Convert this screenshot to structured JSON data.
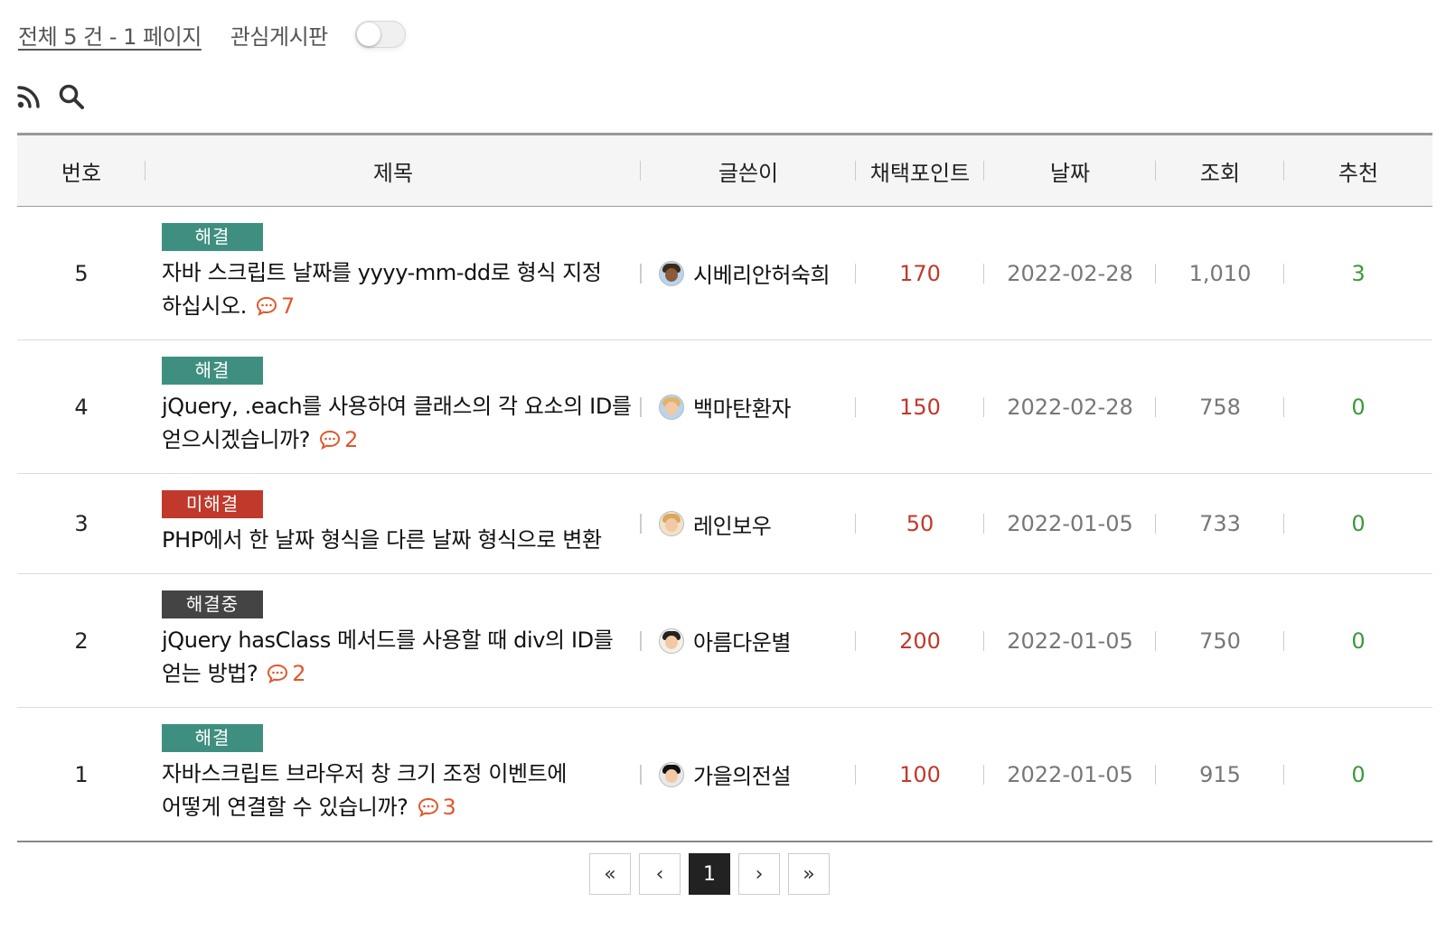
{
  "summary": {
    "total_text": "전체 5 건 - 1 페이지",
    "favorites_label": "관심게시판",
    "favorites_enabled": false
  },
  "tools": {
    "rss_icon": "rss-icon",
    "search_icon": "search-icon"
  },
  "columns": {
    "num": "번호",
    "title": "제목",
    "author": "글쓴이",
    "points": "채택포인트",
    "date": "날짜",
    "views": "조회",
    "recommend": "추천"
  },
  "posts": [
    {
      "num": "5",
      "status": "해결",
      "title": "자바 스크립트 날짜를 yyyy-mm-dd로 형식 지정 하십시오.",
      "comments": "7",
      "author": "시베리안허숙희",
      "points": "170",
      "date": "2022-02-28",
      "views": "1,010",
      "recommend": "3"
    },
    {
      "num": "4",
      "status": "해결",
      "title": "jQuery, .each를 사용하여 클래스의 각 요소의 ID를 얻으시겠습니까?",
      "comments": "2",
      "author": "백마탄환자",
      "points": "150",
      "date": "2022-02-28",
      "views": "758",
      "recommend": "0"
    },
    {
      "num": "3",
      "status": "미해결",
      "title": "PHP에서 한 날짜 형식을 다른 날짜 형식으로 변환",
      "comments": "",
      "author": "레인보우",
      "points": "50",
      "date": "2022-01-05",
      "views": "733",
      "recommend": "0"
    },
    {
      "num": "2",
      "status": "해결중",
      "title": "jQuery hasClass 메서드를 사용할 때 div의 ID를 얻는 방법?",
      "comments": "2",
      "author": "아름다운별",
      "points": "200",
      "date": "2022-01-05",
      "views": "750",
      "recommend": "0"
    },
    {
      "num": "1",
      "status": "해결",
      "title": "자바스크립트 브라우저 창 크기 조정 이벤트에 어떻게 연결할 수 있습니까?",
      "comments": "3",
      "author": "가을의전설",
      "points": "100",
      "date": "2022-01-05",
      "views": "915",
      "recommend": "0"
    }
  ],
  "pagination": {
    "first": "«",
    "prev": "‹",
    "current": "1",
    "next": "›",
    "last": "»"
  },
  "colors": {
    "solved": "#3f8f80",
    "unsolved": "#c0392b",
    "pending": "#444444",
    "points": "#c0392b",
    "recommend": "#3a9a3a",
    "comment": "#e2572b"
  }
}
